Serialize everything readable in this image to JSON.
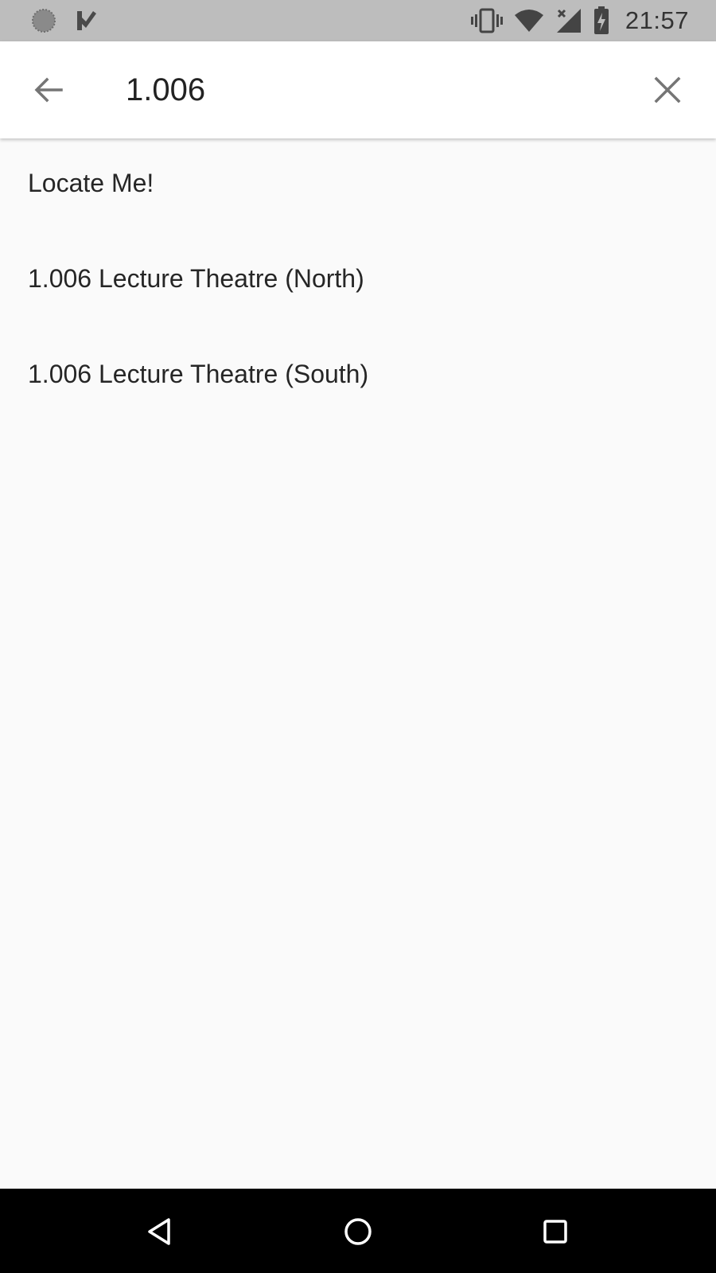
{
  "status_bar": {
    "time": "21:57",
    "left_icons": [
      "circle-notification-icon",
      "checkmark-flag-icon"
    ],
    "right_icons": [
      "vibrate-icon",
      "wifi-icon",
      "cellular-no-data-icon",
      "battery-charging-icon"
    ]
  },
  "search": {
    "query": "1.006",
    "back_icon": "arrow-back-icon",
    "clear_icon": "close-icon"
  },
  "results": [
    {
      "label": "Locate Me!"
    },
    {
      "label": "1.006 Lecture Theatre (North)"
    },
    {
      "label": "1.006 Lecture Theatre (South)"
    }
  ],
  "nav_bar": {
    "buttons": [
      "back-triangle-icon",
      "home-circle-icon",
      "recents-square-icon"
    ]
  },
  "colors": {
    "status_bar_bg": "#bdbdbd",
    "app_bar_bg": "#ffffff",
    "page_bg": "#fafafa",
    "nav_bar_bg": "#000000",
    "text": "#262626",
    "icon_grey": "#757575"
  }
}
